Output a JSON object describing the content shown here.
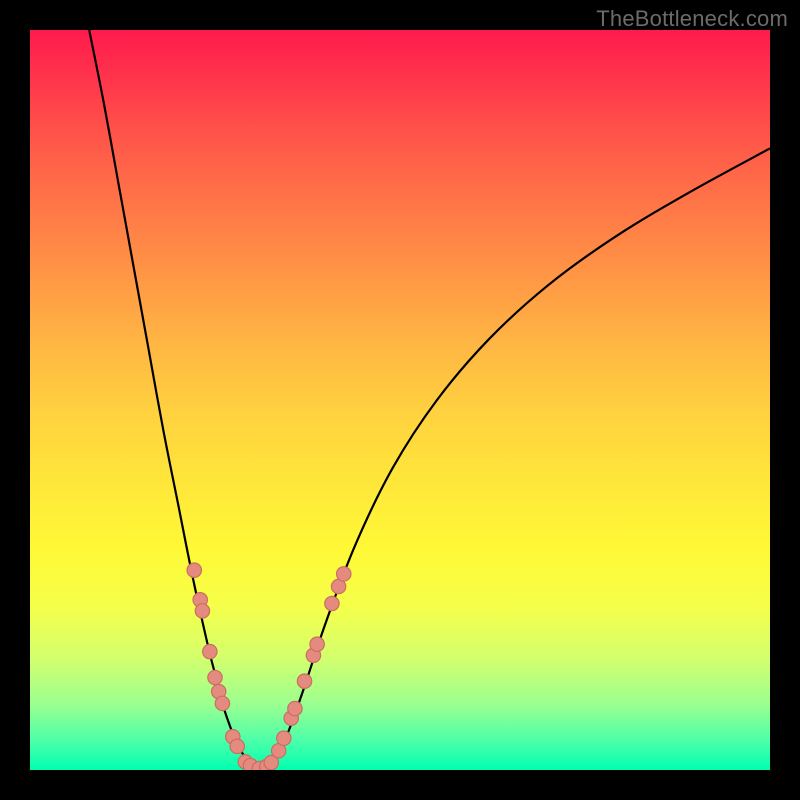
{
  "watermark": "TheBottleneck.com",
  "colors": {
    "background": "#000000",
    "curve": "#000000",
    "dot_fill": "#e58a7e",
    "dot_stroke": "#c86f62",
    "gradient_top": "#ff1a4d",
    "gradient_bottom": "#00ffb0"
  },
  "chart_data": {
    "type": "line",
    "title": "",
    "xlabel": "",
    "ylabel": "",
    "xlim": [
      0,
      100
    ],
    "ylim": [
      0,
      100
    ],
    "series": [
      {
        "name": "bottleneck-curve-left",
        "x": [
          8,
          10,
          12,
          14,
          16,
          18,
          20,
          22,
          24,
          25,
          26,
          27,
          28,
          29,
          30,
          31
        ],
        "y": [
          100,
          90,
          79,
          68,
          57,
          46,
          36,
          26,
          17,
          13,
          9,
          6,
          3.5,
          1.8,
          0.7,
          0.2
        ]
      },
      {
        "name": "bottleneck-curve-right",
        "x": [
          31,
          32,
          33,
          34,
          35,
          37,
          40,
          44,
          49,
          55,
          62,
          70,
          79,
          89,
          100
        ],
        "y": [
          0.2,
          0.6,
          1.6,
          3.2,
          5.4,
          11.0,
          20.0,
          30.5,
          40.8,
          50.0,
          58.2,
          65.5,
          72.0,
          78.0,
          84.0
        ]
      }
    ],
    "points": [
      {
        "name": "left-arm-dot",
        "x": 22.2,
        "y": 27.0
      },
      {
        "name": "left-arm-dot",
        "x": 23.0,
        "y": 23.0
      },
      {
        "name": "left-arm-dot",
        "x": 23.3,
        "y": 21.5
      },
      {
        "name": "left-arm-dot",
        "x": 24.3,
        "y": 16.0
      },
      {
        "name": "left-arm-dot",
        "x": 25.0,
        "y": 12.5
      },
      {
        "name": "left-arm-dot",
        "x": 25.5,
        "y": 10.6
      },
      {
        "name": "left-arm-dot",
        "x": 26.0,
        "y": 9.0
      },
      {
        "name": "left-arm-dot",
        "x": 27.4,
        "y": 4.5
      },
      {
        "name": "left-arm-dot",
        "x": 28.0,
        "y": 3.2
      },
      {
        "name": "bottom-dot",
        "x": 29.1,
        "y": 1.1
      },
      {
        "name": "bottom-dot",
        "x": 29.8,
        "y": 0.6
      },
      {
        "name": "bottom-dot",
        "x": 31.0,
        "y": 0.2
      },
      {
        "name": "bottom-dot",
        "x": 32.0,
        "y": 0.5
      },
      {
        "name": "bottom-dot",
        "x": 32.6,
        "y": 1.0
      },
      {
        "name": "right-arm-dot",
        "x": 33.6,
        "y": 2.6
      },
      {
        "name": "right-arm-dot",
        "x": 34.3,
        "y": 4.3
      },
      {
        "name": "right-arm-dot",
        "x": 35.3,
        "y": 7.0
      },
      {
        "name": "right-arm-dot",
        "x": 35.8,
        "y": 8.3
      },
      {
        "name": "right-arm-dot",
        "x": 37.1,
        "y": 12.0
      },
      {
        "name": "right-arm-dot",
        "x": 38.3,
        "y": 15.5
      },
      {
        "name": "right-arm-dot",
        "x": 38.8,
        "y": 17.0
      },
      {
        "name": "right-arm-dot",
        "x": 40.8,
        "y": 22.5
      },
      {
        "name": "right-arm-dot",
        "x": 41.7,
        "y": 24.8
      },
      {
        "name": "right-arm-dot",
        "x": 42.4,
        "y": 26.5
      }
    ]
  }
}
